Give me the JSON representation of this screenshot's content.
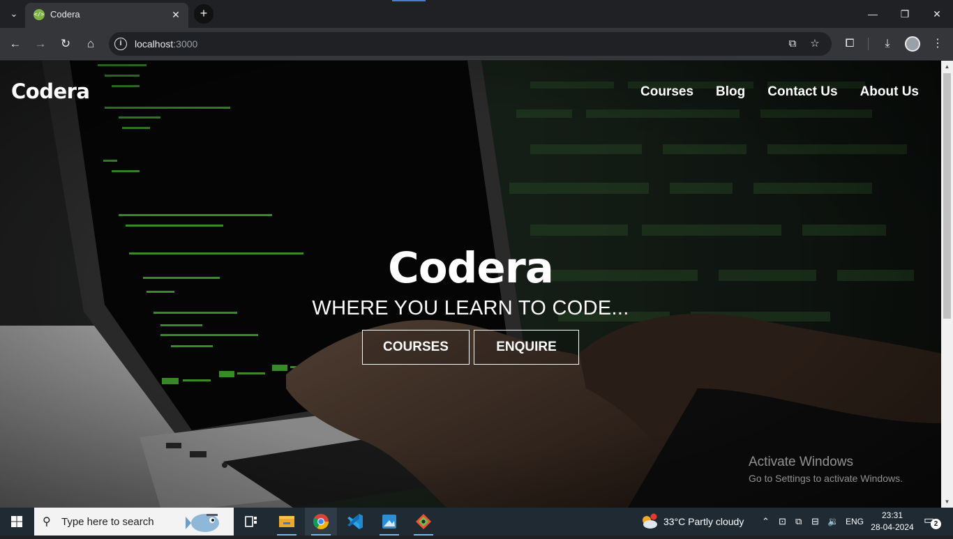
{
  "browser": {
    "tab_title": "Codera",
    "tab_favicon": "</>",
    "url_host": "localhost",
    "url_port": ":3000",
    "icons": [
      "tab-search-icon",
      "close-icon",
      "new-tab-icon",
      "minimize-icon",
      "restore-icon",
      "window-close-icon",
      "back-icon",
      "forward-icon",
      "reload-icon",
      "home-icon",
      "site-info-icon",
      "install-app-icon",
      "bookmark-star-icon",
      "extensions-icon",
      "downloads-icon",
      "profile-avatar-icon",
      "menu-kebab-icon"
    ]
  },
  "site": {
    "brand": "Codera",
    "nav": [
      "Courses",
      "Blog",
      "Contact Us",
      "About Us"
    ],
    "hero_title": "Codera",
    "hero_subtitle": "WHERE YOU LEARN TO CODE...",
    "btn_courses": "COURSES",
    "btn_enquire": "ENQUIRE"
  },
  "watermark": {
    "line1": "Activate Windows",
    "line2": "Go to Settings to activate Windows."
  },
  "taskbar": {
    "search_placeholder": "Type here to search",
    "weather": "33°C  Partly cloudy",
    "language": "ENG",
    "time": "23:31",
    "date": "28-04-2024",
    "notifications": "2",
    "apps": [
      "task-view",
      "file-explorer",
      "chrome",
      "vscode",
      "paint-app",
      "git-app"
    ]
  }
}
